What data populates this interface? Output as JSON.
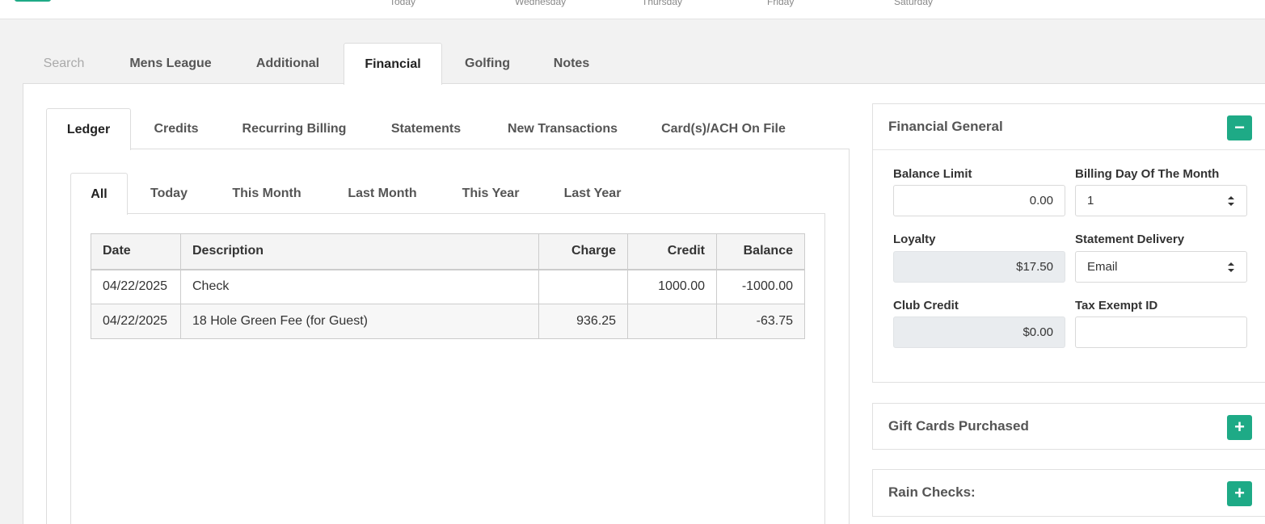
{
  "top": {
    "days": [
      "Today",
      "Wednesday",
      "Thursday",
      "Friday",
      "Saturday"
    ]
  },
  "main_tabs": [
    {
      "label": "Search"
    },
    {
      "label": "Mens League"
    },
    {
      "label": "Additional"
    },
    {
      "label": "Financial"
    },
    {
      "label": "Golfing"
    },
    {
      "label": "Notes"
    }
  ],
  "sub_tabs": [
    {
      "label": "Ledger"
    },
    {
      "label": "Credits"
    },
    {
      "label": "Recurring Billing"
    },
    {
      "label": "Statements"
    },
    {
      "label": "New Transactions"
    },
    {
      "label": "Card(s)/ACH On File"
    }
  ],
  "range_tabs": [
    {
      "label": "All"
    },
    {
      "label": "Today"
    },
    {
      "label": "This Month"
    },
    {
      "label": "Last Month"
    },
    {
      "label": "This Year"
    },
    {
      "label": "Last Year"
    }
  ],
  "ledger": {
    "headers": {
      "date": "Date",
      "description": "Description",
      "charge": "Charge",
      "credit": "Credit",
      "balance": "Balance"
    },
    "rows": [
      {
        "date": "04/22/2025",
        "description": "Check",
        "charge": "",
        "credit": "1000.00",
        "balance": "-1000.00"
      },
      {
        "date": "04/22/2025",
        "description": "18 Hole Green Fee (for Guest)",
        "charge": "936.25",
        "credit": "",
        "balance": "-63.75"
      }
    ]
  },
  "financial_general": {
    "title": "Financial General",
    "toggle": "−",
    "balance_limit_label": "Balance Limit",
    "balance_limit_value": "0.00",
    "billing_day_label": "Billing Day Of The Month",
    "billing_day_value": "1",
    "loyalty_label": "Loyalty",
    "loyalty_value": "$17.50",
    "statement_delivery_label": "Statement Delivery",
    "statement_delivery_value": "Email",
    "club_credit_label": "Club Credit",
    "club_credit_value": "$0.00",
    "tax_exempt_label": "Tax Exempt ID",
    "tax_exempt_value": ""
  },
  "gift_cards": {
    "title": "Gift Cards Purchased",
    "toggle": "+"
  },
  "rain_checks": {
    "title": "Rain Checks:",
    "toggle": "+"
  },
  "colors": {
    "accent": "#1eaa86"
  }
}
